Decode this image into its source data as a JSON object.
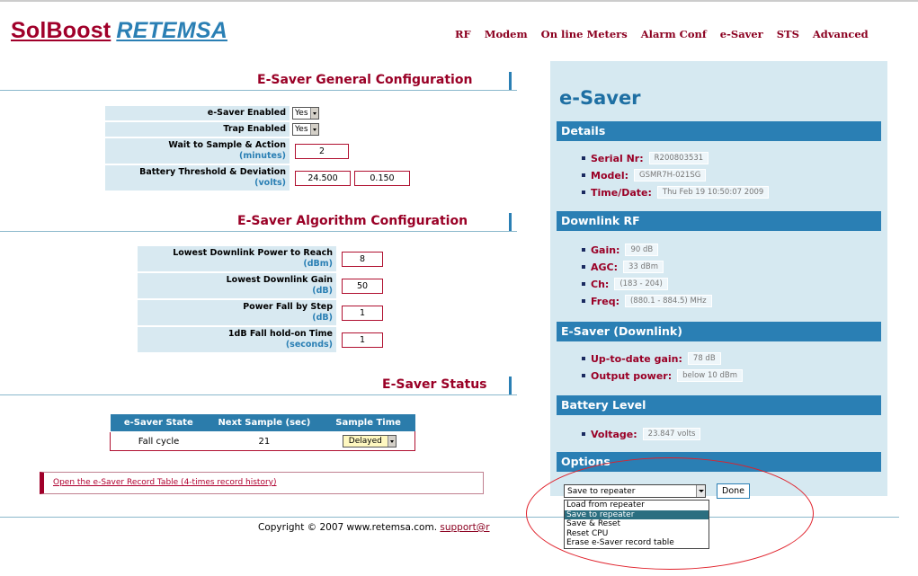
{
  "logo": {
    "part1": "SolBoost",
    "part2": "RETEMSA"
  },
  "nav": [
    "RF",
    "Modem",
    "On line Meters",
    "Alarm Conf",
    "e-Saver",
    "STS",
    "Advanced"
  ],
  "general": {
    "title": "E-Saver General Configuration",
    "esaver_enabled": {
      "label": "e-Saver Enabled",
      "value": "Yes"
    },
    "trap_enabled": {
      "label": "Trap Enabled",
      "value": "Yes"
    },
    "wait": {
      "label": "Wait to Sample & Action",
      "unit": "(minutes)",
      "value": "2"
    },
    "battery": {
      "label": "Battery Threshold & Deviation",
      "unit": "(volts)",
      "threshold": "24.500",
      "deviation": "0.150"
    }
  },
  "algorithm": {
    "title": "E-Saver Algorithm Configuration",
    "rows": [
      {
        "label": "Lowest Downlink Power to Reach",
        "unit": "(dBm)",
        "value": "8"
      },
      {
        "label": "Lowest Downlink Gain",
        "unit": "(dB)",
        "value": "50"
      },
      {
        "label": "Power Fall by Step",
        "unit": "(dB)",
        "value": "1"
      },
      {
        "label": "1dB Fall hold-on Time",
        "unit": "(seconds)",
        "value": "1"
      }
    ]
  },
  "status": {
    "title": "E-Saver Status",
    "headers": [
      "e-Saver State",
      "Next Sample (sec)",
      "Sample Time"
    ],
    "state": "Fall cycle",
    "next_sample": "21",
    "sample_time": "Delayed"
  },
  "record_link": "Open the e-Saver Record Table (4-times record history)",
  "footer": {
    "text": "Copyright © 2007 www.retemsa.com.",
    "mail": "support@r"
  },
  "panel": {
    "title": "e-Saver",
    "details": {
      "header": "Details",
      "serial_label": "Serial Nr:",
      "serial": "R200803531",
      "model_label": "Model:",
      "model": "GSMR7H-021SG",
      "time_label": "Time/Date:",
      "time": "Thu Feb 19 10:50:07 2009"
    },
    "downlink": {
      "header": "Downlink RF",
      "gain_label": "Gain:",
      "gain": "90 dB",
      "agc_label": "AGC:",
      "agc": "33 dBm",
      "ch_label": "Ch:",
      "ch": "(183 - 204)",
      "freq_label": "Freq:",
      "freq": "(880.1 - 884.5) MHz"
    },
    "esaver_dl": {
      "header": "E-Saver (Downlink)",
      "gain_label": "Up-to-date gain:",
      "gain": "78 dB",
      "power_label": "Output power:",
      "power": "below 10 dBm"
    },
    "battery": {
      "header": "Battery Level",
      "voltage_label": "Voltage:",
      "voltage": "23.847 volts"
    },
    "options": {
      "header": "Options",
      "selected": "Save to repeater",
      "done": "Done",
      "list": [
        "Load from repeater",
        "Save to repeater",
        "Save & Reset",
        "Reset CPU",
        "Erase e-Saver record table"
      ]
    }
  },
  "colors": {
    "brand": "#a0002a",
    "accent": "#2a7fb4",
    "panel": "#d6e9f1",
    "annotation": "#e0202a"
  }
}
